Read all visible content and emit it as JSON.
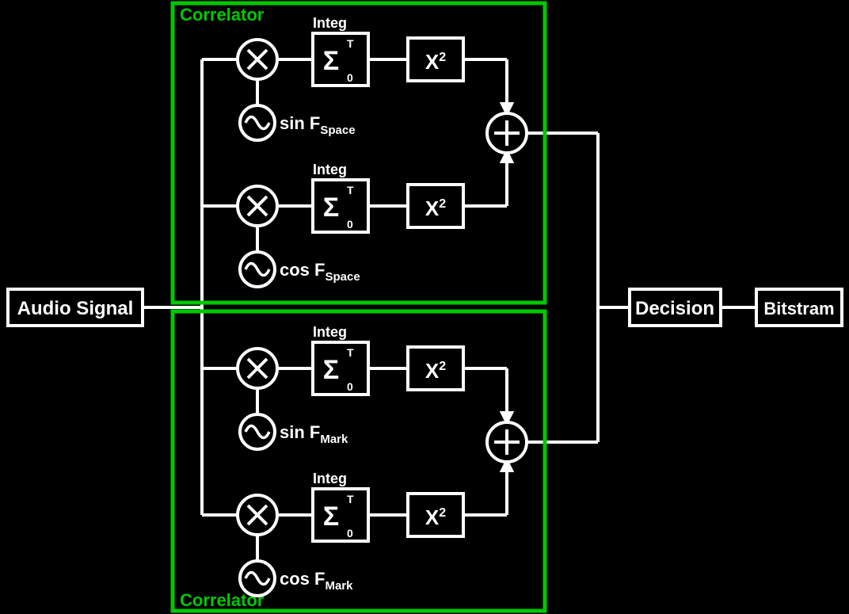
{
  "input_label": "Audio Signal",
  "correlator_label": "Correlator",
  "integ_label": "Integ",
  "integ_upper": "T",
  "integ_lower": "0",
  "square_label_base": "X",
  "square_label_exp": "2",
  "osc_sin": "sin F",
  "osc_cos": "cos F",
  "subscript_space": "Space",
  "subscript_mark": "Mark",
  "decision_label": "Decision",
  "output_label": "Bitstram",
  "sigma": "Σ"
}
